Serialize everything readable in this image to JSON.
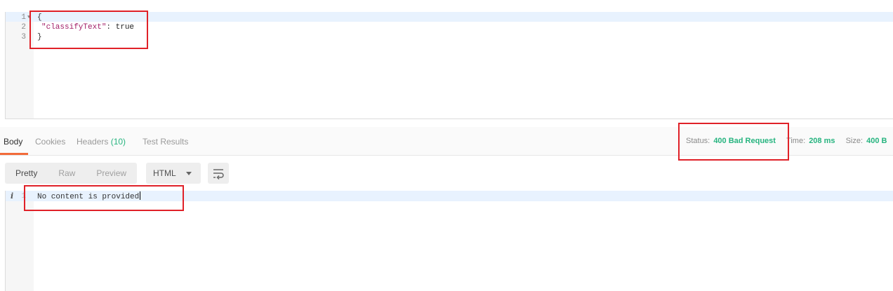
{
  "request_editor": {
    "lines": [
      {
        "num": "1",
        "text": "{"
      },
      {
        "num": "2",
        "key": "\"classifyText\"",
        "sep": ": ",
        "value": "true"
      },
      {
        "num": "3",
        "text": "}"
      }
    ]
  },
  "response": {
    "tabs": [
      {
        "label": "Body"
      },
      {
        "label": "Cookies"
      },
      {
        "label": "Headers",
        "count": "(10)"
      },
      {
        "label": "Test Results"
      }
    ],
    "status_label": "Status:",
    "status_value": "400 Bad Request",
    "time_label": "Time:",
    "time_value": "208 ms",
    "size_label": "Size:",
    "size_value": "400 B",
    "view_modes": [
      "Pretty",
      "Raw",
      "Preview"
    ],
    "format": "HTML",
    "body_lines": [
      {
        "num": "1",
        "text": "No content is provided"
      }
    ]
  },
  "icons": {
    "fold": "fold-arrow-icon",
    "caret": "chevron-down-icon",
    "wrap": "wrap-lines-icon",
    "info": "info-icon"
  },
  "colors": {
    "accent": "#f26b3a",
    "success": "#26b47f",
    "annotation": "#e02128",
    "json_key": "#a11d66"
  }
}
